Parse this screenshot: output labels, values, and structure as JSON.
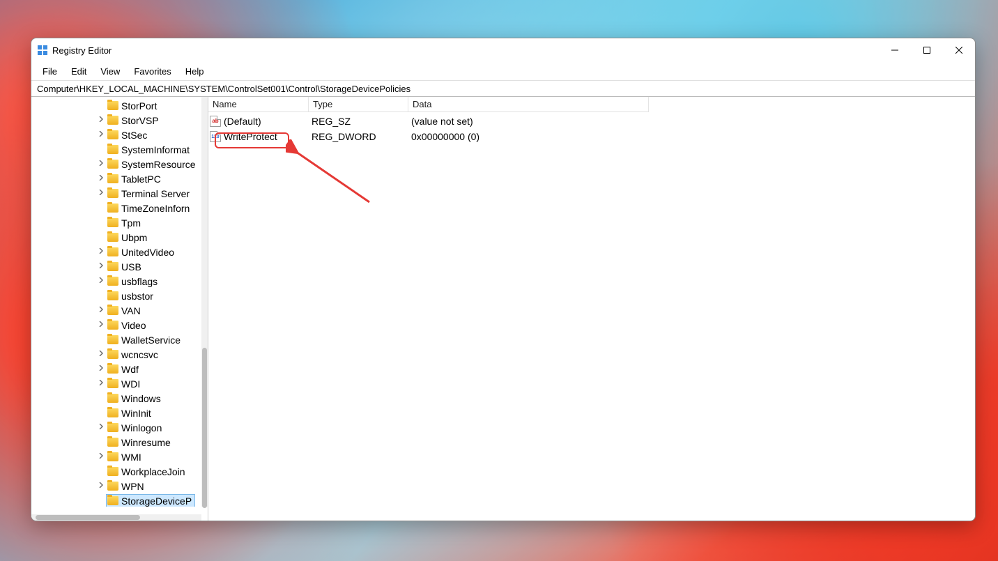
{
  "window": {
    "title": "Registry Editor",
    "address": "Computer\\HKEY_LOCAL_MACHINE\\SYSTEM\\ControlSet001\\Control\\StorageDevicePolicies"
  },
  "menubar": [
    "File",
    "Edit",
    "View",
    "Favorites",
    "Help"
  ],
  "tree": [
    {
      "label": "StorPort",
      "expander": "none"
    },
    {
      "label": "StorVSP",
      "expander": "closed"
    },
    {
      "label": "StSec",
      "expander": "closed"
    },
    {
      "label": "SystemInformat",
      "expander": "none"
    },
    {
      "label": "SystemResource",
      "expander": "closed"
    },
    {
      "label": "TabletPC",
      "expander": "closed"
    },
    {
      "label": "Terminal Server",
      "expander": "closed"
    },
    {
      "label": "TimeZoneInforn",
      "expander": "none"
    },
    {
      "label": "Tpm",
      "expander": "none"
    },
    {
      "label": "Ubpm",
      "expander": "none"
    },
    {
      "label": "UnitedVideo",
      "expander": "closed"
    },
    {
      "label": "USB",
      "expander": "closed"
    },
    {
      "label": "usbflags",
      "expander": "closed"
    },
    {
      "label": "usbstor",
      "expander": "none"
    },
    {
      "label": "VAN",
      "expander": "closed"
    },
    {
      "label": "Video",
      "expander": "closed"
    },
    {
      "label": "WalletService",
      "expander": "none"
    },
    {
      "label": "wcncsvc",
      "expander": "closed"
    },
    {
      "label": "Wdf",
      "expander": "closed"
    },
    {
      "label": "WDI",
      "expander": "closed"
    },
    {
      "label": "Windows",
      "expander": "none"
    },
    {
      "label": "WinInit",
      "expander": "none"
    },
    {
      "label": "Winlogon",
      "expander": "closed"
    },
    {
      "label": "Winresume",
      "expander": "none"
    },
    {
      "label": "WMI",
      "expander": "closed"
    },
    {
      "label": "WorkplaceJoin",
      "expander": "none"
    },
    {
      "label": "WPN",
      "expander": "closed"
    },
    {
      "label": "StorageDeviceP",
      "expander": "none",
      "selected": true
    }
  ],
  "columns": {
    "name": "Name",
    "type": "Type",
    "data": "Data"
  },
  "values": [
    {
      "icon": "sz",
      "name": "(Default)",
      "type": "REG_SZ",
      "data": "(value not set)",
      "highlighted": false
    },
    {
      "icon": "dw",
      "name": "WriteProtect",
      "type": "REG_DWORD",
      "data": "0x00000000 (0)",
      "highlighted": true
    }
  ],
  "icons": {
    "sz_text": "ab",
    "dw_text": "110"
  }
}
